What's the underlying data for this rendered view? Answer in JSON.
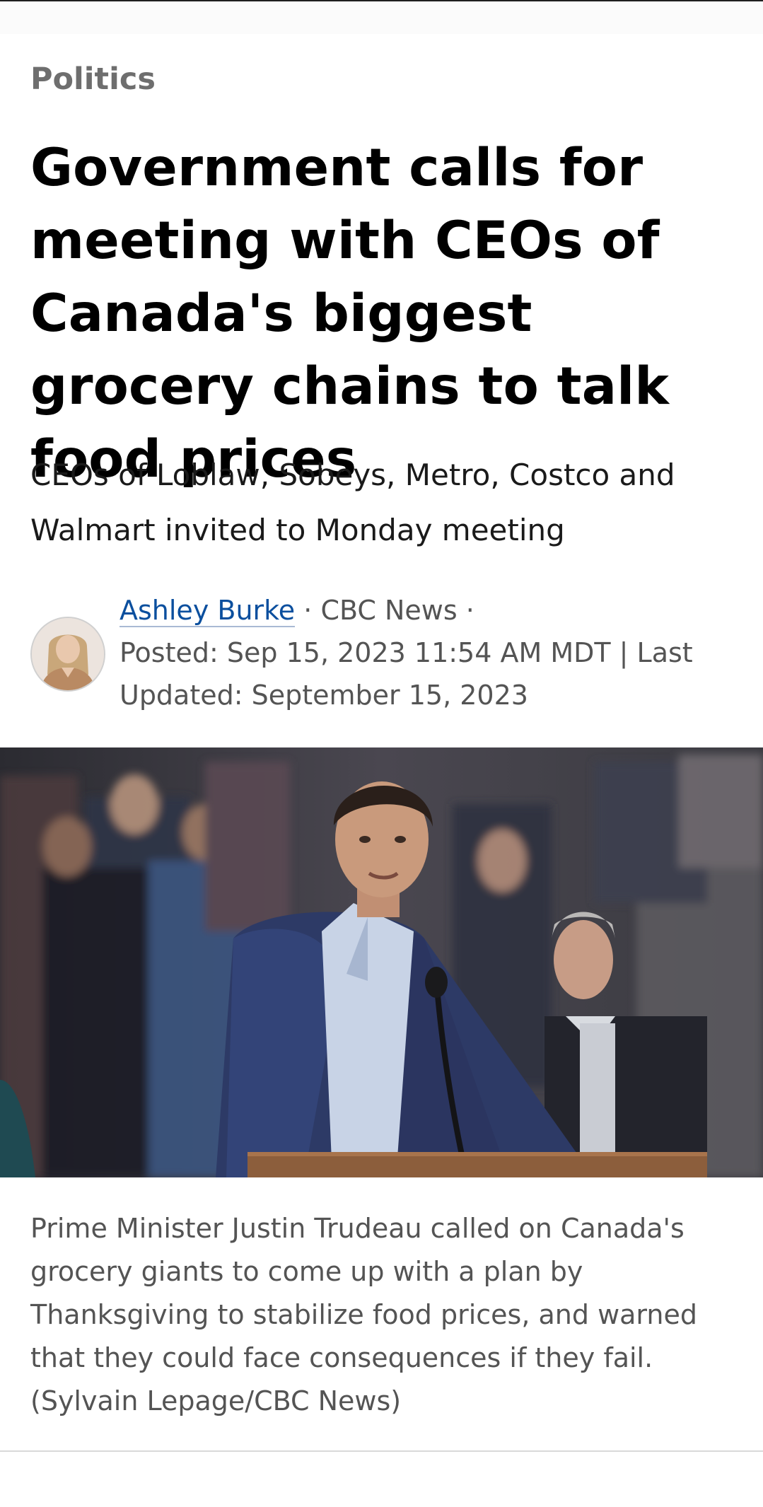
{
  "article": {
    "section": "Politics",
    "headline": "Government calls for meeting with CEOs of Canada's biggest grocery chains to talk food prices",
    "deck": "CEOs of Loblaw, Sobeys, Metro, Costco and Walmart invited to Monday meeting",
    "byline": {
      "author": "Ashley Burke",
      "separator_1": " · ",
      "outlet": "CBC News",
      "separator_2": " · ",
      "posted": "Posted: Sep 15, 2023 11:54 AM MDT | Last Updated: September 15, 2023"
    },
    "photo_caption": "Prime Minister Justin Trudeau called on Canada's grocery giants to come up with a plan by Thanksgiving to stabilize food prices, and warned that they could face consequences if they fail. (Sylvain Lepage/CBC News)"
  },
  "colors": {
    "section_label": "#6e6e6e",
    "author_link": "#0b4f9e",
    "meta_text": "#545454"
  }
}
